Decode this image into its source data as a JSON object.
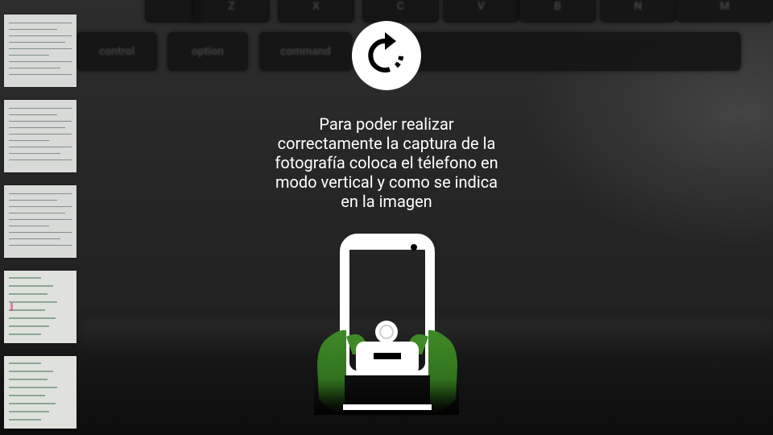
{
  "instruction": {
    "lines": [
      "Para poder realizar",
      "correctamente la captura de la",
      "fotografía coloca el télefono en",
      "modo vertical y como se indica",
      "en la imagen"
    ]
  },
  "icons": {
    "rotate": "rotate-icon",
    "phone": "phone-in-hands-icon"
  },
  "colors": {
    "overlay_text": "#ffffff",
    "hand_green": "#3a7d24",
    "icon_bg": "#ffffff"
  },
  "thumbnails": [
    {
      "label": "document-thumbnail-1"
    },
    {
      "label": "document-thumbnail-2"
    },
    {
      "label": "document-thumbnail-3"
    },
    {
      "label": "document-thumbnail-4"
    },
    {
      "label": "document-thumbnail-5"
    },
    {
      "label": "document-thumbnail-6"
    }
  ],
  "background_keys": {
    "top_row": [
      "Z",
      "X",
      "C",
      "V",
      "B",
      "N",
      "M"
    ],
    "bottom_row": [
      "control",
      "option",
      "command"
    ]
  }
}
